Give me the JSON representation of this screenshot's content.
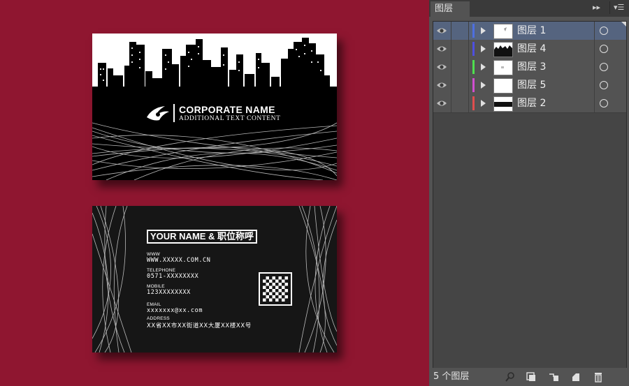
{
  "front_card": {
    "corporate_name": "CORPORATE NAME",
    "subtitle": "ADDITIONAL TEXT CONTENT",
    "logo_icon": "corporate-logo-icon"
  },
  "back_card": {
    "name_title": "YOUR NAME  &  职位称呼",
    "fields": [
      {
        "label": "WWW",
        "value": "WWW.XXXXX.COM.CN"
      },
      {
        "label": "TELEPHONE",
        "value": "0571-XXXXXXXX"
      },
      {
        "label": "MOBILE",
        "value": "123XXXXXXXX"
      },
      {
        "label": "EMAIL",
        "value": "xxxxxxx@xx.com"
      },
      {
        "label": "ADDRESS",
        "value": "XX省XX市XX街道XX大厦XX楼XX号"
      }
    ],
    "qr_icon": "qr-code-icon"
  },
  "layers_panel": {
    "tab_label": "图层",
    "collapse_icon": "double-chevron-right-icon",
    "menu_icon": "panel-menu-icon",
    "layers": [
      {
        "name": "图层 1",
        "color": "#4e6fe0",
        "selected": true
      },
      {
        "name": "图层 4",
        "color": "#4e4fe0",
        "selected": false
      },
      {
        "name": "图层 3",
        "color": "#4ee04e",
        "selected": false
      },
      {
        "name": "图层 5",
        "color": "#d04ed0",
        "selected": false
      },
      {
        "name": "图层 2",
        "color": "#e04e4e",
        "selected": false
      }
    ],
    "footer_count": "5 个图层",
    "footer_icons": [
      "locate-object-icon",
      "make-clipping-mask-icon",
      "create-sublayer-icon",
      "create-new-layer-icon",
      "trash-icon"
    ]
  },
  "colors": {
    "canvas_background": "#8f1630",
    "panel_background": "#535353",
    "selected_row": "#55647f"
  }
}
